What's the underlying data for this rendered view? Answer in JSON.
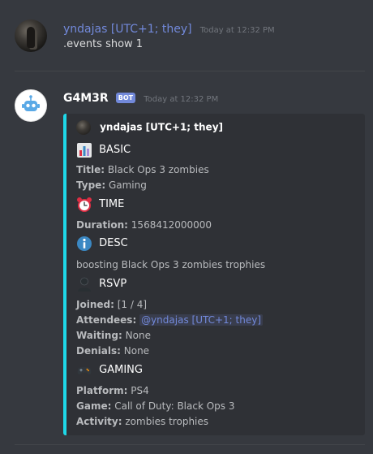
{
  "messages": [
    {
      "author": "yndajas [UTC+1; they]",
      "timestamp": "Today at 12:32 PM",
      "content": ".events show 1"
    },
    {
      "author": "G4M3R",
      "bot_tag": "BOT",
      "timestamp": "Today at 12:32 PM"
    }
  ],
  "embed": {
    "accent_color": "#1ed8e8",
    "author": "yndajas [UTC+1; they]",
    "sections": {
      "basic": {
        "icon": "bar-chart-icon",
        "title": "BASIC",
        "title_key": "Title:",
        "title_value": "Black Ops 3 zombies",
        "type_key": "Type:",
        "type_value": "Gaming"
      },
      "time": {
        "icon": "alarm-clock-icon",
        "title": "TIME",
        "duration_key": "Duration:",
        "duration_value": "1568412000000"
      },
      "desc": {
        "icon": "information-icon",
        "title": "DESC",
        "text": "boosting Black Ops 3 zombies trophies"
      },
      "rsvp": {
        "icon": "bust-silhouette-icon",
        "title": "RSVP",
        "joined_key": "Joined:",
        "joined_value": "[1 / 4]",
        "attendees_key": "Attendees:",
        "attendees_value": "@yndajas [UTC+1; they]",
        "waiting_key": "Waiting:",
        "waiting_value": "None",
        "denials_key": "Denials:",
        "denials_value": "None"
      },
      "gaming": {
        "icon": "gamepad-icon",
        "title": "GAMING",
        "platform_key": "Platform:",
        "platform_value": "PS4",
        "game_key": "Game:",
        "game_value": "Call of Duty: Black Ops 3",
        "activity_key": "Activity:",
        "activity_value": "zombies trophies"
      }
    }
  }
}
